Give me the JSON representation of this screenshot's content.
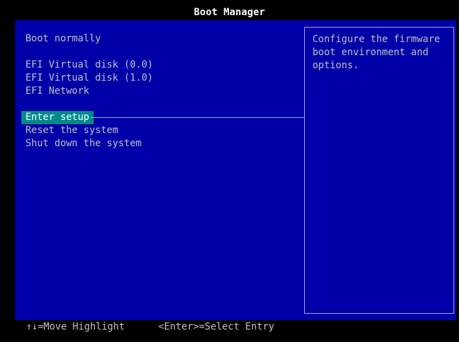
{
  "window": {
    "title": "Boot Manager"
  },
  "menu": {
    "items": [
      {
        "label": "Boot normally",
        "selected": false
      },
      {
        "label": "EFI Virtual disk (0.0)",
        "selected": false
      },
      {
        "label": "EFI Virtual disk (1.0)",
        "selected": false
      },
      {
        "label": "EFI Network",
        "selected": false
      },
      {
        "label": "Enter setup",
        "selected": true
      },
      {
        "label": "Reset the system",
        "selected": false
      },
      {
        "label": "Shut down the system",
        "selected": false
      }
    ]
  },
  "help": {
    "text": "Configure the firmware\nboot environment and\noptions."
  },
  "footer": {
    "move_hint": "↑↓=Move Highlight",
    "select_hint": "<Enter>=Select Entry"
  },
  "colors": {
    "background": "#000000",
    "panel": "#0000a8",
    "highlight": "#008b8b",
    "text": "#c0c0c0",
    "title": "#ffffff"
  }
}
